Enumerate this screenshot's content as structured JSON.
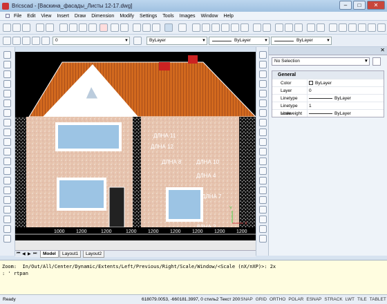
{
  "window": {
    "title": "Bricscad - [Васкина_фасады_Листы 12-17.dwg]"
  },
  "menu": [
    "File",
    "Edit",
    "View",
    "Insert",
    "Draw",
    "Dimension",
    "Modify",
    "Settings",
    "Tools",
    "Images",
    "Window",
    "Help"
  ],
  "layer_toolbar": {
    "layer_value": "0",
    "color_value": "ByLayer",
    "linetype_value": "ByLayer",
    "lineweight_value": "ByLayer"
  },
  "properties": {
    "selection": "No Selection",
    "category": "General",
    "rows": [
      {
        "key": "Color",
        "value": "ByLayer"
      },
      {
        "key": "Layer",
        "value": "0"
      },
      {
        "key": "Linetype",
        "value": "ByLayer"
      },
      {
        "key": "Linetype scale",
        "value": "1"
      },
      {
        "key": "Lineweight",
        "value": "ByLayer"
      }
    ]
  },
  "drawing": {
    "labels": [
      "ДЛНА 11",
      "ДЛНА 12",
      "ДЛНА 8",
      "ДЛНА 10",
      "ДЛНА 4",
      "ДЛНА 7",
      "ДЛНА 2"
    ],
    "dims": [
      "1000",
      "1200",
      "1200",
      "1200",
      "1200",
      "1200",
      "1200",
      "1200",
      "1200"
    ],
    "ucs_y": "Y",
    "ucs_x": "X"
  },
  "tabs": {
    "model": "Model",
    "layout1": "Layout1",
    "layout2": "Layout2"
  },
  "command": {
    "line1": "Zoom:  In/Out/All/Center/Dynamic/Extents/Left/Previous/Right/Scale/Window/<Scale (nX/nXP)>: 2x",
    "line2": ": ' rtpan"
  },
  "status": {
    "ready": "Ready",
    "coords": "618079.0053, -660181.3997, 0  стиль2  Текст 200",
    "modes": [
      "SNAP",
      "GRID",
      "ORTHO",
      "POLAR",
      "ESNAP",
      "STRACK",
      "LWT",
      "TILE",
      "TABLET"
    ]
  },
  "colors": {
    "roof": "#d2691e",
    "wall": "#e8c4b0",
    "glass": "#9cc4e4"
  }
}
